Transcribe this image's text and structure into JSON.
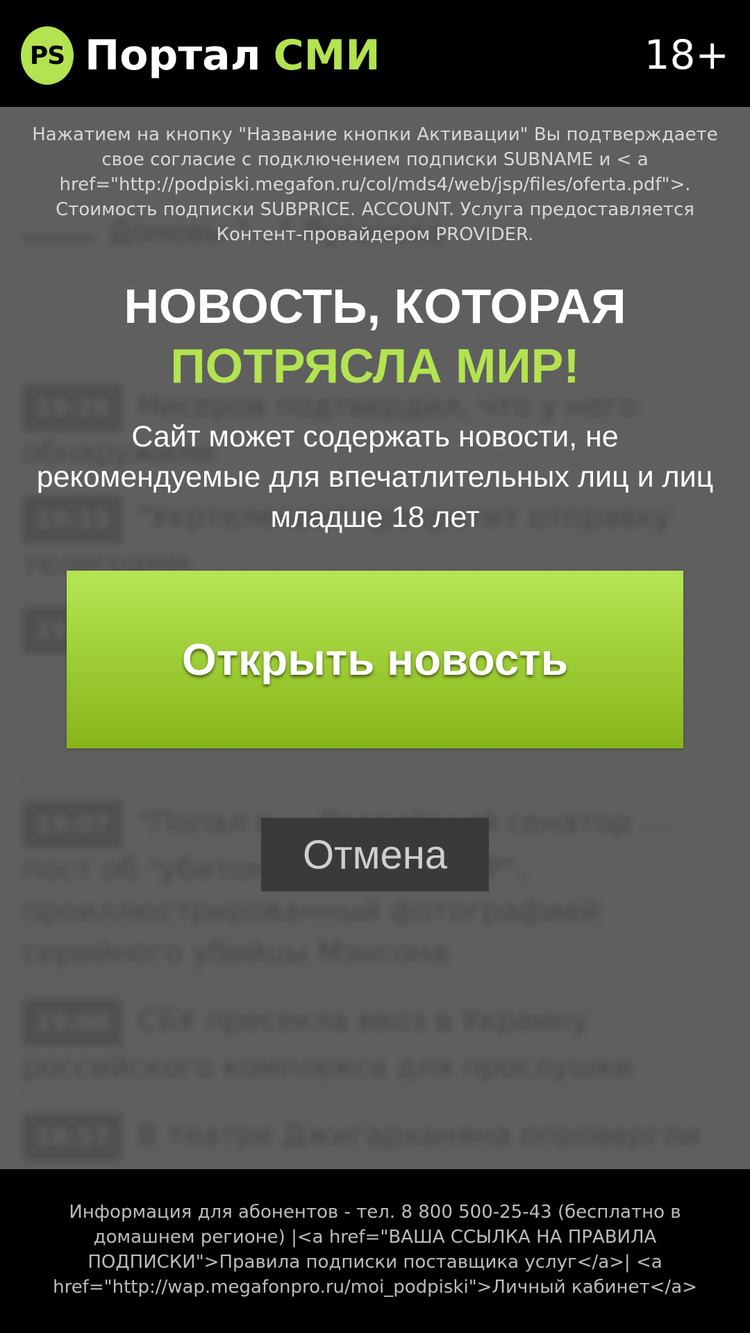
{
  "header": {
    "logo_badge": "PS",
    "logo_part1": "Портал",
    "logo_part2": "СМИ",
    "age_rating": "18+"
  },
  "notice": "Нажатием на кнопку \"Название кнопки Активации\" Вы подтверждаете свое согласие с подключением подписки SUBNAME и < a href=\"http://podpiski.megafon.ru/col/mds4/web/jsp/files/oferta.pdf\">. Стоимость подписки SUBPRICE. ACCOUNT. Услуга предоставляется Контент-провайдером PROVIDER.",
  "headline": {
    "line1": "НОВОСТЬ, КОТОРАЯ",
    "line2": "ПОТРЯСЛА МИР!"
  },
  "subtext": "Сайт может содержать новости, не рекомендуемые для впечатлительных лиц и лиц младше 18 лет",
  "buttons": {
    "open": "Открыть новость",
    "cancel": "Отмена"
  },
  "footer": "Информация для абонентов - тел. 8 800 500-25-43 (бесплатно в домашнем регионе) |<a href=\"ВАША ССЫЛКА НА ПРАВИЛА ПОДПИСКИ\">Правила подписки поставщика услуг</a>| <a href=\"http://wap.megafonpro.ru/moi_podpiski\">Личный кабинет</a>",
  "colors": {
    "accent": "#b3e350",
    "header_bg": "#000000",
    "button_top": "#b6e653",
    "button_bottom": "#86b519"
  },
  "background_news": [
    {
      "time": "",
      "text": "Доневы \"…\" Луганска"
    },
    {
      "time": "19:26",
      "text": "Нисеров подтвердил, что у него обнаружили"
    },
    {
      "time": "19:15",
      "text": "\"Укртелеком\" прекратит отправку телеграмм"
    },
    {
      "time": "19:10",
      "text": ""
    },
    {
      "time": "19:07",
      "text": "\"Попал в … Российский сенатор … пост об \"убитом\" боевике \"ЛНР\", проиллюстрированный фотографией серийного убийцы Мэнсона"
    },
    {
      "time": "19:00",
      "text": "СБУ пресекла ввоз в Украину российского комплекса для прослушки"
    },
    {
      "time": "18:57",
      "text": "В театре Джигарханяна опровергли"
    }
  ]
}
